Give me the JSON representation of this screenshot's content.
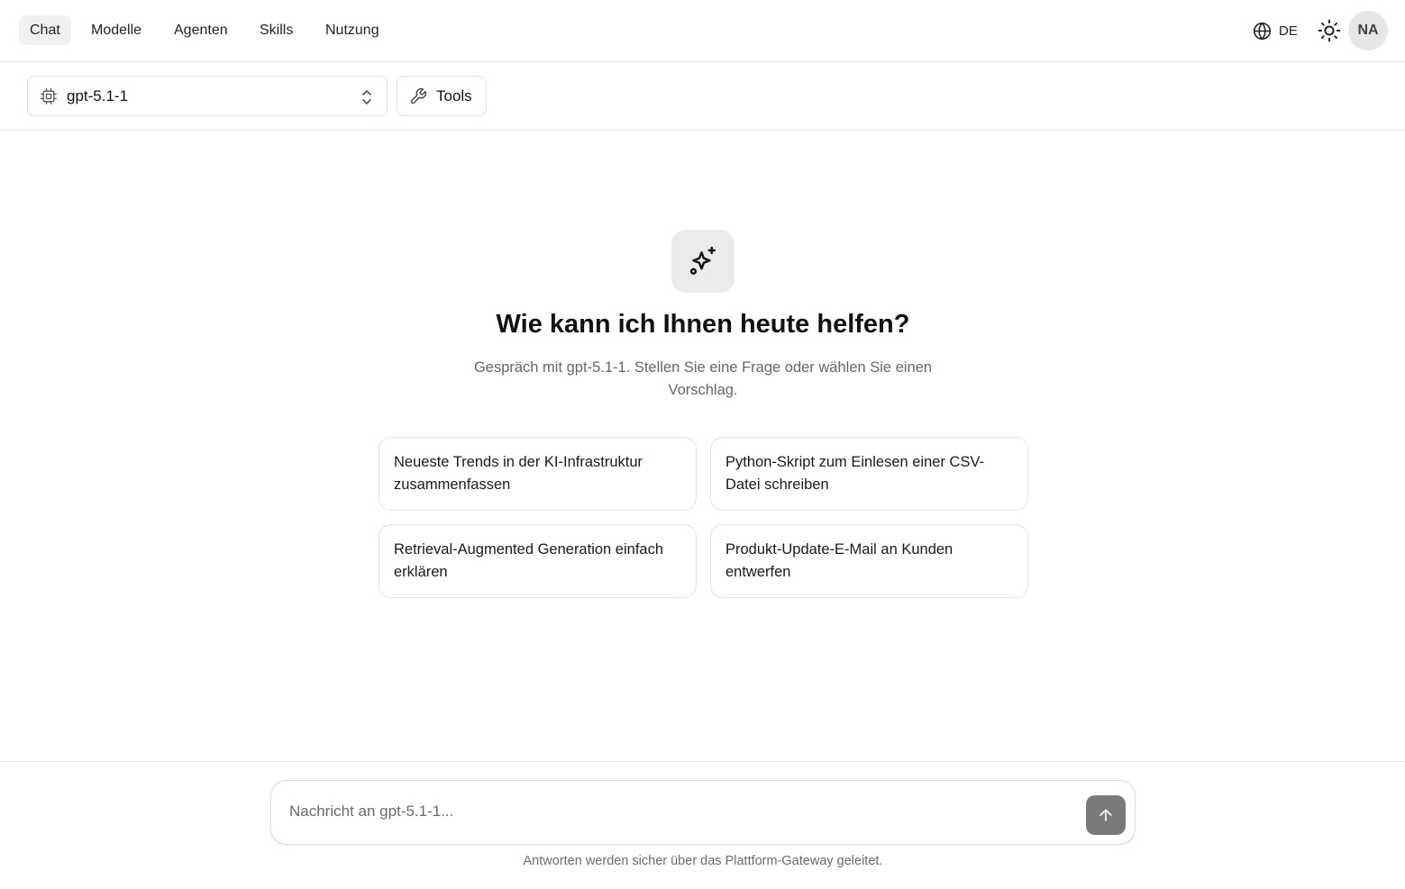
{
  "nav": {
    "items": [
      {
        "label": "Chat",
        "active": true
      },
      {
        "label": "Modelle",
        "active": false
      },
      {
        "label": "Agenten",
        "active": false
      },
      {
        "label": "Skills",
        "active": false
      },
      {
        "label": "Nutzung",
        "active": false
      }
    ],
    "language": "DE",
    "avatar_initials": "NA",
    "icons": {
      "language": "globe-icon",
      "theme": "sun-icon"
    }
  },
  "toolbar": {
    "model_label": "gpt-5.1-1",
    "tools_label": "Tools",
    "icons": {
      "model": "chip-icon",
      "chevron": "chevron-updown-icon",
      "tools": "wrench-icon"
    }
  },
  "hero": {
    "icon": "sparkles-icon",
    "title": "Wie kann ich Ihnen heute helfen?",
    "subtitle": "Gespräch mit gpt-5.1-1. Stellen Sie eine Frage oder wählen Sie einen Vorschlag."
  },
  "suggestions": [
    "Neueste Trends in der KI-Infrastruktur zusammenfassen",
    "Python-Skript zum Einlesen einer CSV-Datei schreiben",
    "Retrieval-Augmented Generation einfach erklären",
    "Produkt-Update-E-Mail an Kunden entwerfen"
  ],
  "composer": {
    "placeholder": "Nachricht an gpt-5.1-1...",
    "value": "",
    "send_icon": "arrow-up-icon",
    "footnote": "Antworten werden sicher über das Plattform-Gateway geleitet."
  },
  "colors": {
    "border": "#e6e6e6",
    "active_tab_bg": "#f0f0f0",
    "send_button": "#7a7a7a",
    "muted_text": "#666666"
  }
}
